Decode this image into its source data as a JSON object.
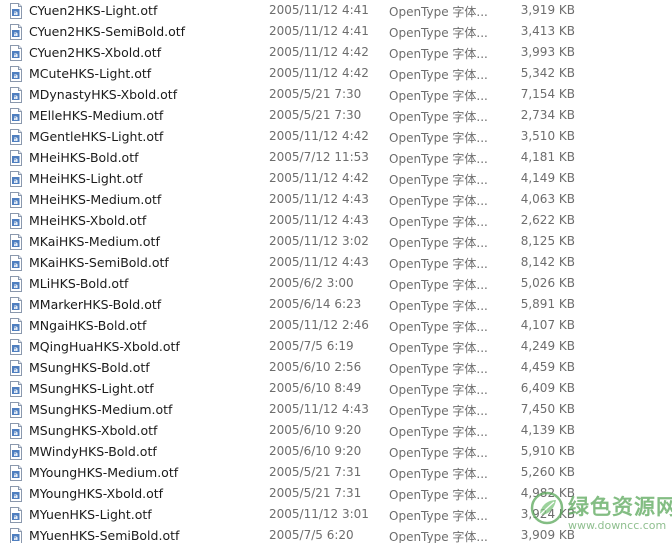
{
  "file_list": {
    "type_label": "OpenType 字体...",
    "icon": "font-file-icon",
    "rows": [
      {
        "name": "CYuen2HKS-Light.otf",
        "date": "2005/11/12 4:41",
        "type": "OpenType 字体...",
        "size": "3,919 KB"
      },
      {
        "name": "CYuen2HKS-SemiBold.otf",
        "date": "2005/11/12 4:41",
        "type": "OpenType 字体...",
        "size": "3,413 KB"
      },
      {
        "name": "CYuen2HKS-Xbold.otf",
        "date": "2005/11/12 4:42",
        "type": "OpenType 字体...",
        "size": "3,993 KB"
      },
      {
        "name": "MCuteHKS-Light.otf",
        "date": "2005/11/12 4:42",
        "type": "OpenType 字体...",
        "size": "5,342 KB"
      },
      {
        "name": "MDynastyHKS-Xbold.otf",
        "date": "2005/5/21 7:30",
        "type": "OpenType 字体...",
        "size": "7,154 KB"
      },
      {
        "name": "MElleHKS-Medium.otf",
        "date": "2005/5/21 7:30",
        "type": "OpenType 字体...",
        "size": "2,734 KB"
      },
      {
        "name": "MGentleHKS-Light.otf",
        "date": "2005/11/12 4:42",
        "type": "OpenType 字体...",
        "size": "3,510 KB"
      },
      {
        "name": "MHeiHKS-Bold.otf",
        "date": "2005/7/12 11:53",
        "type": "OpenType 字体...",
        "size": "4,181 KB"
      },
      {
        "name": "MHeiHKS-Light.otf",
        "date": "2005/11/12 4:42",
        "type": "OpenType 字体...",
        "size": "4,149 KB"
      },
      {
        "name": "MHeiHKS-Medium.otf",
        "date": "2005/11/12 4:43",
        "type": "OpenType 字体...",
        "size": "4,063 KB"
      },
      {
        "name": "MHeiHKS-Xbold.otf",
        "date": "2005/11/12 4:43",
        "type": "OpenType 字体...",
        "size": "2,622 KB"
      },
      {
        "name": "MKaiHKS-Medium.otf",
        "date": "2005/11/12 3:02",
        "type": "OpenType 字体...",
        "size": "8,125 KB"
      },
      {
        "name": "MKaiHKS-SemiBold.otf",
        "date": "2005/11/12 4:43",
        "type": "OpenType 字体...",
        "size": "8,142 KB"
      },
      {
        "name": "MLiHKS-Bold.otf",
        "date": "2005/6/2 3:00",
        "type": "OpenType 字体...",
        "size": "5,026 KB"
      },
      {
        "name": "MMarkerHKS-Bold.otf",
        "date": "2005/6/14 6:23",
        "type": "OpenType 字体...",
        "size": "5,891 KB"
      },
      {
        "name": "MNgaiHKS-Bold.otf",
        "date": "2005/11/12 2:46",
        "type": "OpenType 字体...",
        "size": "4,107 KB"
      },
      {
        "name": "MQingHuaHKS-Xbold.otf",
        "date": "2005/7/5 6:19",
        "type": "OpenType 字体...",
        "size": "4,249 KB"
      },
      {
        "name": "MSungHKS-Bold.otf",
        "date": "2005/6/10 2:56",
        "type": "OpenType 字体...",
        "size": "4,459 KB"
      },
      {
        "name": "MSungHKS-Light.otf",
        "date": "2005/6/10 8:49",
        "type": "OpenType 字体...",
        "size": "6,409 KB"
      },
      {
        "name": "MSungHKS-Medium.otf",
        "date": "2005/11/12 4:43",
        "type": "OpenType 字体...",
        "size": "7,450 KB"
      },
      {
        "name": "MSungHKS-Xbold.otf",
        "date": "2005/6/10 9:20",
        "type": "OpenType 字体...",
        "size": "4,139 KB"
      },
      {
        "name": "MWindyHKS-Bold.otf",
        "date": "2005/6/10 9:20",
        "type": "OpenType 字体...",
        "size": "5,910 KB"
      },
      {
        "name": "MYoungHKS-Medium.otf",
        "date": "2005/5/21 7:31",
        "type": "OpenType 字体...",
        "size": "5,260 KB"
      },
      {
        "name": "MYoungHKS-Xbold.otf",
        "date": "2005/5/21 7:31",
        "type": "OpenType 字体...",
        "size": "4,982 KB"
      },
      {
        "name": "MYuenHKS-Light.otf",
        "date": "2005/11/12 3:01",
        "type": "OpenType 字体...",
        "size": "3,924 KB"
      },
      {
        "name": "MYuenHKS-SemiBold.otf",
        "date": "2005/7/5 6:20",
        "type": "OpenType 字体...",
        "size": "3,909 KB"
      }
    ]
  },
  "watermark": {
    "title": "绿色资源网",
    "url": "www.downcc.com",
    "color": "#5aa85a",
    "icon": "leaf-logo-icon"
  }
}
